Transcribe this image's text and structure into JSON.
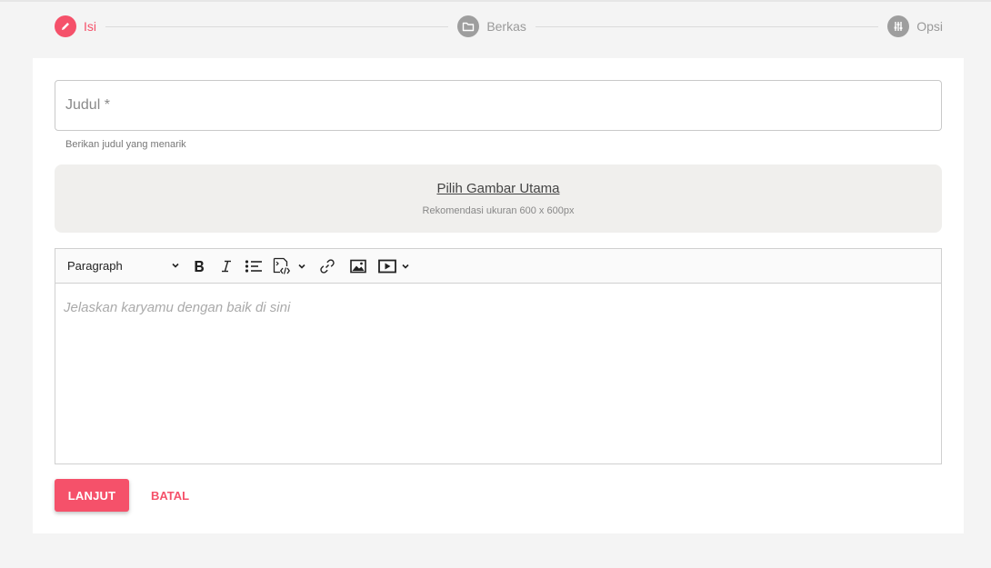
{
  "colors": {
    "accent": "#f5516a",
    "inactive_step": "#9e9e9e",
    "upload_bg": "#f0efed"
  },
  "stepper": {
    "steps": [
      {
        "label": "Isi",
        "icon": "pencil-icon",
        "active": true
      },
      {
        "label": "Berkas",
        "icon": "folder-icon",
        "active": false
      },
      {
        "label": "Opsi",
        "icon": "sliders-icon",
        "active": false
      }
    ]
  },
  "form": {
    "title_placeholder": "Judul *",
    "title_helper": "Berikan judul yang menarik",
    "upload": {
      "link_label": "Pilih Gambar Utama",
      "hint": "Rekomendasi ukuran 600 x 600px"
    },
    "editor": {
      "paragraph_select": "Paragraph",
      "toolbar_icons": [
        "chevron-down-icon",
        "bold-icon",
        "italic-icon",
        "bulleted-list-icon",
        "html-embed-icon",
        "link-icon",
        "image-icon",
        "media-icon"
      ],
      "placeholder": "Jelaskan karyamu dengan baik di sini"
    }
  },
  "actions": {
    "next_label": "LANJUT",
    "cancel_label": "BATAL"
  }
}
